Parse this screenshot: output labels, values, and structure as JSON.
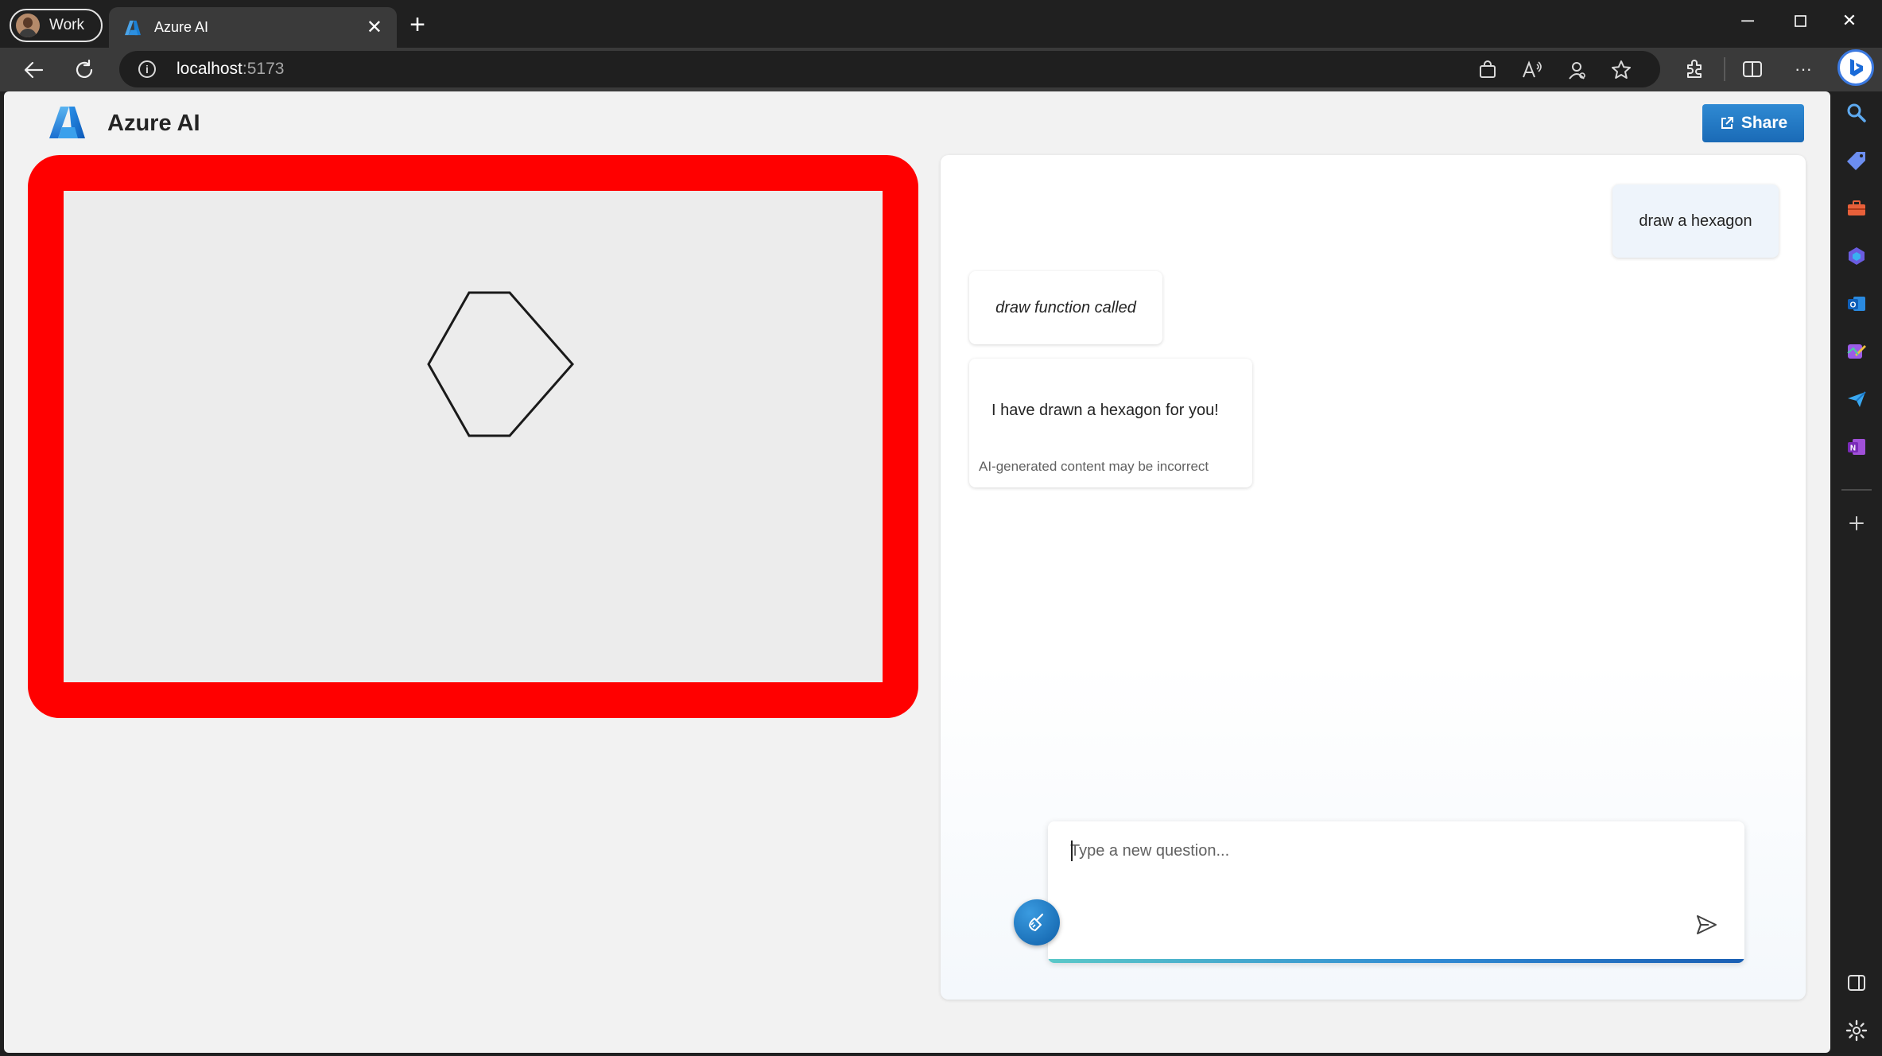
{
  "browser": {
    "profile_label": "Work",
    "tab_title": "Azure AI",
    "url_host": "localhost",
    "url_port": ":5173",
    "toolbar_icons": [
      "shopping-bag-icon",
      "read-aloud-icon",
      "performance-icon",
      "favorites-star-icon",
      "extensions-icon",
      "split-screen-icon",
      "more-icon",
      "copilot-icon"
    ],
    "sidebar_icons": [
      "search-icon",
      "tag-icon",
      "toolbox-icon",
      "copilot-m365-icon",
      "outlook-icon",
      "designer-icon",
      "send-icon",
      "onenote-icon",
      "add-icon",
      "sidebar-toggle-icon",
      "settings-icon"
    ]
  },
  "app": {
    "title": "Azure AI",
    "share_label": "Share",
    "accent_color": "#1a6ab6",
    "canvas_frame_color": "#ff0000"
  },
  "canvas": {
    "shape": "hexagon"
  },
  "chat": {
    "messages": [
      {
        "role": "user",
        "text": "draw a hexagon"
      },
      {
        "role": "function",
        "text": "draw function called"
      },
      {
        "role": "assistant",
        "text": "I have drawn a hexagon for you!",
        "note": "AI-generated content may be incorrect"
      }
    ],
    "input": {
      "placeholder": "Type a new question...",
      "value": ""
    }
  }
}
